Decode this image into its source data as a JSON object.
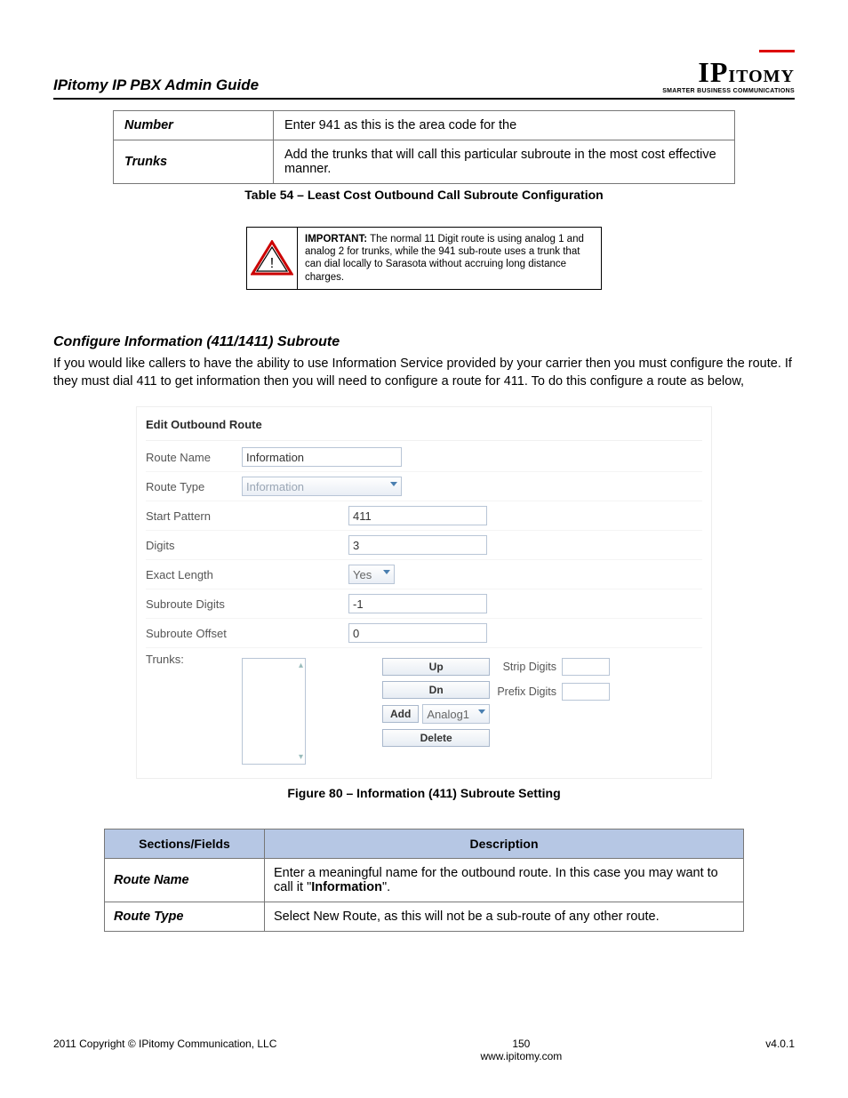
{
  "header": {
    "title": "IPitomy IP PBX Admin Guide",
    "brand_top": "IPITOMY",
    "brand_sub": "SMARTER BUSINESS COMMUNICATIONS"
  },
  "top_table": {
    "rows": [
      {
        "label": "Number",
        "desc": "Enter 941 as this is the area code for the"
      },
      {
        "label": "Trunks",
        "desc": "Add the trunks that will call this particular subroute in the most cost effective manner."
      }
    ],
    "caption": "Table 54 – Least Cost Outbound Call Subroute Configuration"
  },
  "important": {
    "lead": "IMPORTANT:",
    "text": "The normal 11 Digit route is using analog 1 and analog 2 for trunks, while the 941 sub-route uses a trunk that can dial locally to Sarasota without accruing long distance charges."
  },
  "section": {
    "heading": "Configure Information (411/1411) Subroute",
    "paragraph": "If you would like callers to have the ability to use Information Service provided by your carrier then you must configure the route. If they must dial 411 to get information then you will need to configure a route for 411. To do this configure a route as below,"
  },
  "ui": {
    "panel_title": "Edit Outbound Route",
    "labels": {
      "route_name": "Route Name",
      "route_type": "Route Type",
      "start_pattern": "Start Pattern",
      "digits": "Digits",
      "exact_length": "Exact Length",
      "subroute_digits": "Subroute Digits",
      "subroute_offset": "Subroute Offset",
      "trunks": "Trunks:",
      "strip_digits": "Strip Digits",
      "prefix_digits": "Prefix Digits"
    },
    "values": {
      "route_name": "Information",
      "route_type": "Information",
      "start_pattern": "411",
      "digits": "3",
      "exact_length": "Yes",
      "subroute_digits": "-1",
      "subroute_offset": "0",
      "add_select": "Analog1"
    },
    "buttons": {
      "up": "Up",
      "dn": "Dn",
      "add": "Add",
      "delete": "Delete"
    }
  },
  "figure_caption": "Figure 80 – Information (411) Subroute Setting",
  "blue_table": {
    "headers": {
      "c1": "Sections/Fields",
      "c2": "Description"
    },
    "rows": [
      {
        "label": "Route Name",
        "desc_pre": "Enter a meaningful name for the outbound route. In this case you may want to call it \"",
        "desc_bold": "Information",
        "desc_post": "\"."
      },
      {
        "label": "Route Type",
        "desc_pre": "Select New Route, as this will not be a sub-route of any other route.",
        "desc_bold": "",
        "desc_post": ""
      }
    ]
  },
  "footer": {
    "left": "2011 Copyright © IPitomy Communication, LLC",
    "page": "150",
    "url": "www.ipitomy.com",
    "right": "v4.0.1"
  }
}
